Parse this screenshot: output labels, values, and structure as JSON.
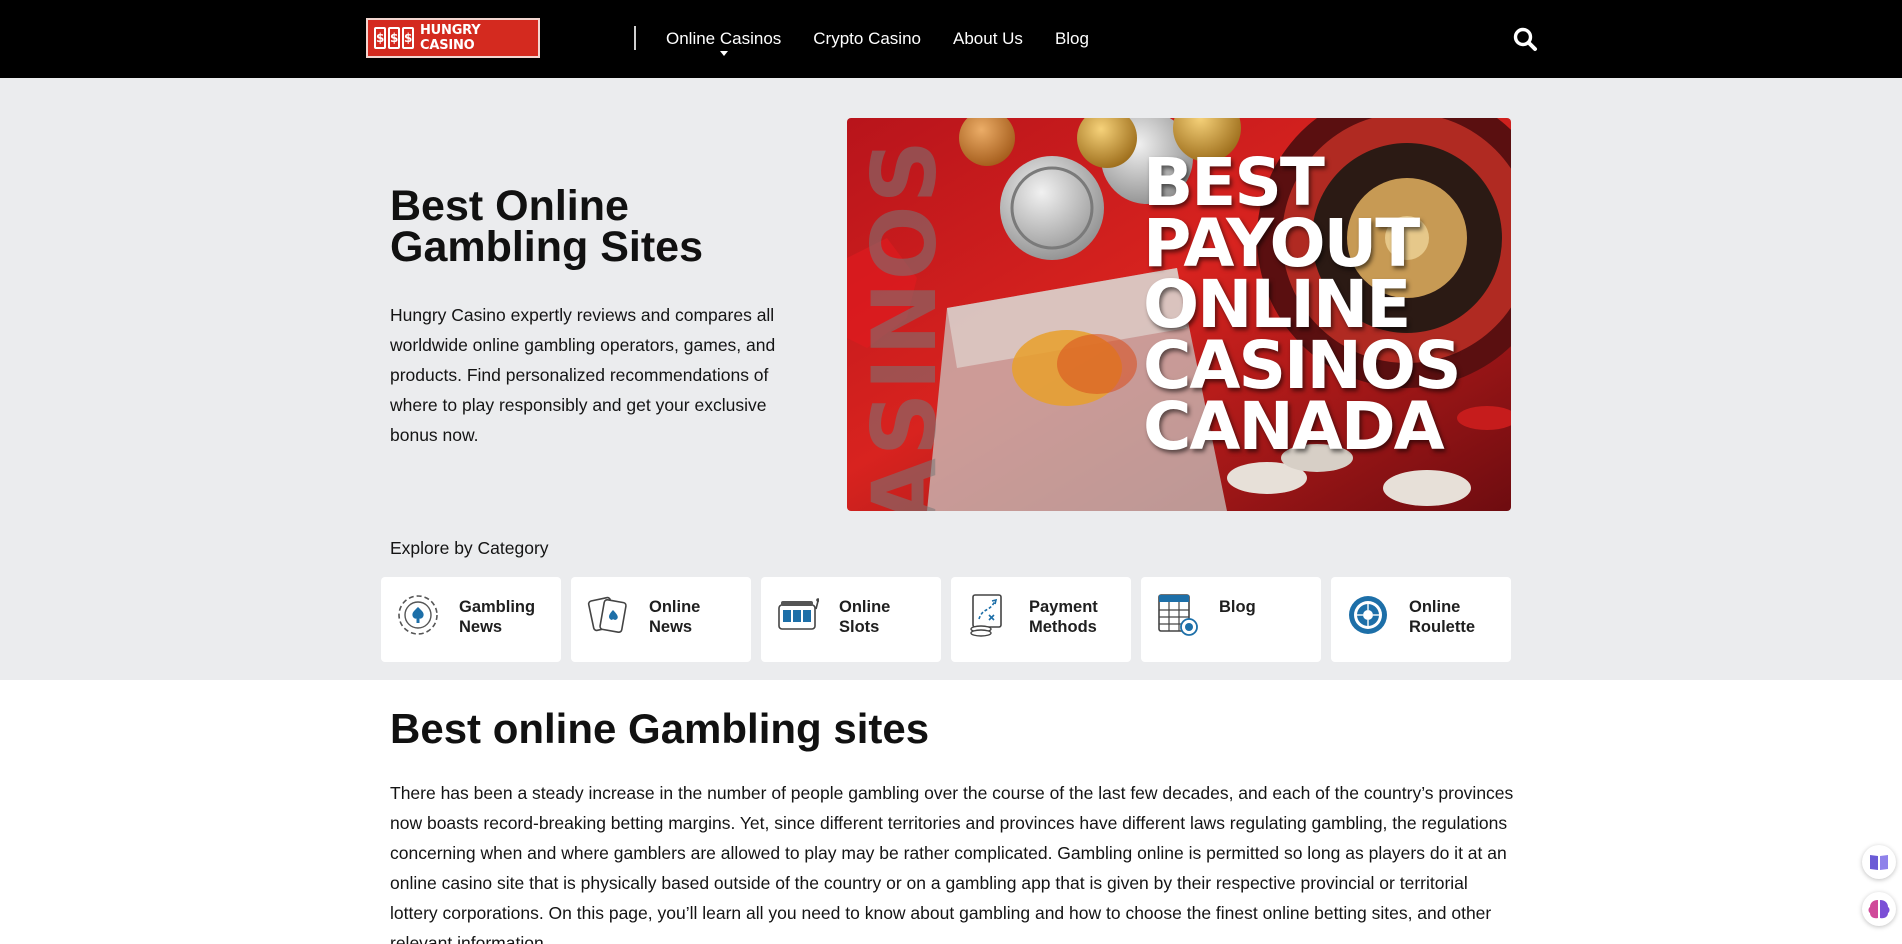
{
  "header": {
    "logo_text": "HUNGRY CASINO",
    "logo_symbols": [
      "$",
      "$",
      "$"
    ],
    "nav": [
      {
        "label": "Online Casinos",
        "has_dropdown": true
      },
      {
        "label": "Crypto Casino"
      },
      {
        "label": "About Us"
      },
      {
        "label": "Blog"
      }
    ],
    "search_icon": "search-icon"
  },
  "hero": {
    "title": "Best Online Gambling Sites",
    "description": "Hungry Casino expertly reviews and compares all worldwide online gambling operators, games, and products. Find personalized recommendations of where to play responsibly and get your exclusive bonus now.",
    "image_text_lines": [
      "BEST",
      "PAYOUT",
      "ONLINE",
      "CASINOS",
      "CANADA"
    ],
    "image_side_text": "CASINOS"
  },
  "explore": {
    "label": "Explore by Category",
    "categories": [
      {
        "label": "Gambling News",
        "icon": "chip-icon"
      },
      {
        "label": "Online News",
        "icon": "cards-icon"
      },
      {
        "label": "Online Slots",
        "icon": "slot-machine-icon"
      },
      {
        "label": "Payment Methods",
        "icon": "strategy-board-icon"
      },
      {
        "label": "Blog",
        "icon": "calculator-icon"
      },
      {
        "label": "Online Roulette",
        "icon": "roulette-icon"
      }
    ]
  },
  "article": {
    "title": "Best online Gambling sites",
    "body": "There has been a steady increase in the number of people gambling over the course of the last few decades, and each of the country’s provinces now boasts record-breaking betting margins. Yet, since different territories and provinces have different laws regulating gambling, the regulations concerning when and where gamblers are allowed to play may be rather complicated. Gambling online is permitted so long as players do it at an online casino site that is physically based outside of the country or on a gambling app that is given by their respective provincial or territorial lottery corporations. On this page, you’ll learn all you need to know about gambling and how to choose the finest online betting sites, and other relevant information."
  },
  "widgets": {
    "reader_icon": "book-icon",
    "ai_icon": "brain-icon"
  },
  "colors": {
    "header_bg": "#000000",
    "logo_red": "#d42a1f",
    "hero_bg": "#ebecee",
    "icon_blue": "#1d6fa8"
  }
}
